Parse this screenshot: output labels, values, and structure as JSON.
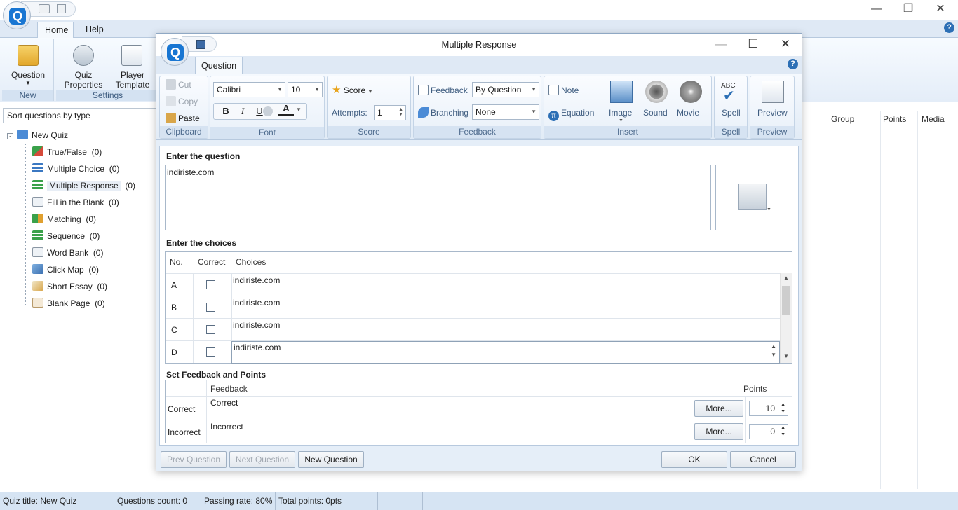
{
  "app": {
    "tabs": [
      "Home",
      "Help"
    ],
    "ribbon": {
      "question": "Question",
      "new_group": "New",
      "quiz_properties": "Quiz Properties",
      "player_template": "Player Template",
      "settings_group": "Settings"
    },
    "sort_select": "Sort questions by type",
    "tree": {
      "root": "New Quiz",
      "items": [
        {
          "label": "True/False",
          "count": "(0)"
        },
        {
          "label": "Multiple Choice",
          "count": "(0)"
        },
        {
          "label": "Multiple Response",
          "count": "(0)"
        },
        {
          "label": "Fill in the Blank",
          "count": "(0)"
        },
        {
          "label": "Matching",
          "count": "(0)"
        },
        {
          "label": "Sequence",
          "count": "(0)"
        },
        {
          "label": "Word Bank",
          "count": "(0)"
        },
        {
          "label": "Click Map",
          "count": "(0)"
        },
        {
          "label": "Short Essay",
          "count": "(0)"
        },
        {
          "label": "Blank Page",
          "count": "(0)"
        }
      ]
    },
    "list_columns": {
      "group": "Group",
      "points": "Points",
      "media": "Media"
    },
    "status": {
      "quiz_title": "Quiz title: New Quiz",
      "questions_count": "Questions count: 0",
      "passing_rate": "Passing rate: 80%",
      "total_points": "Total points: 0pts"
    }
  },
  "dialog": {
    "title": "Multiple Response",
    "tab": "Question",
    "clipboard": {
      "cut": "Cut",
      "copy": "Copy",
      "paste": "Paste",
      "label": "Clipboard"
    },
    "font": {
      "family": "Calibri",
      "size": "10",
      "bold": "B",
      "italic": "I",
      "underline": "U",
      "color": "A",
      "label": "Font"
    },
    "score": {
      "score": "Score",
      "attempts_label": "Attempts:",
      "attempts_value": "1",
      "label": "Score"
    },
    "feedback": {
      "feedback_label": "Feedback",
      "feedback_value": "By Question",
      "branching_label": "Branching",
      "branching_value": "None",
      "label": "Feedback"
    },
    "insert": {
      "note": "Note",
      "equation": "Equation",
      "image": "Image",
      "sound": "Sound",
      "movie": "Movie",
      "label": "Insert"
    },
    "spell": {
      "spell": "Spell",
      "abc": "ABC",
      "label": "Spell"
    },
    "preview": {
      "preview": "Preview",
      "label": "Preview"
    },
    "question_section": "Enter the question",
    "question_text": "indiriste.com",
    "choices_section": "Enter the choices",
    "choices_columns": {
      "no": "No.",
      "correct": "Correct",
      "choices": "Choices"
    },
    "choices": [
      {
        "no": "A",
        "text": "indiriste.com"
      },
      {
        "no": "B",
        "text": "indiriste.com"
      },
      {
        "no": "C",
        "text": "indiriste.com"
      },
      {
        "no": "D",
        "text": "indiriste.com"
      }
    ],
    "feedback_section": "Set Feedback and Points",
    "fb_columns": {
      "feedback": "Feedback",
      "points": "Points"
    },
    "fb_rows": [
      {
        "label": "Correct",
        "text": "Correct",
        "more": "More...",
        "points": "10"
      },
      {
        "label": "Incorrect",
        "text": "Incorrect",
        "more": "More...",
        "points": "0"
      }
    ],
    "buttons": {
      "prev": "Prev Question",
      "next": "Next Question",
      "new": "New Question",
      "ok": "OK",
      "cancel": "Cancel"
    }
  }
}
